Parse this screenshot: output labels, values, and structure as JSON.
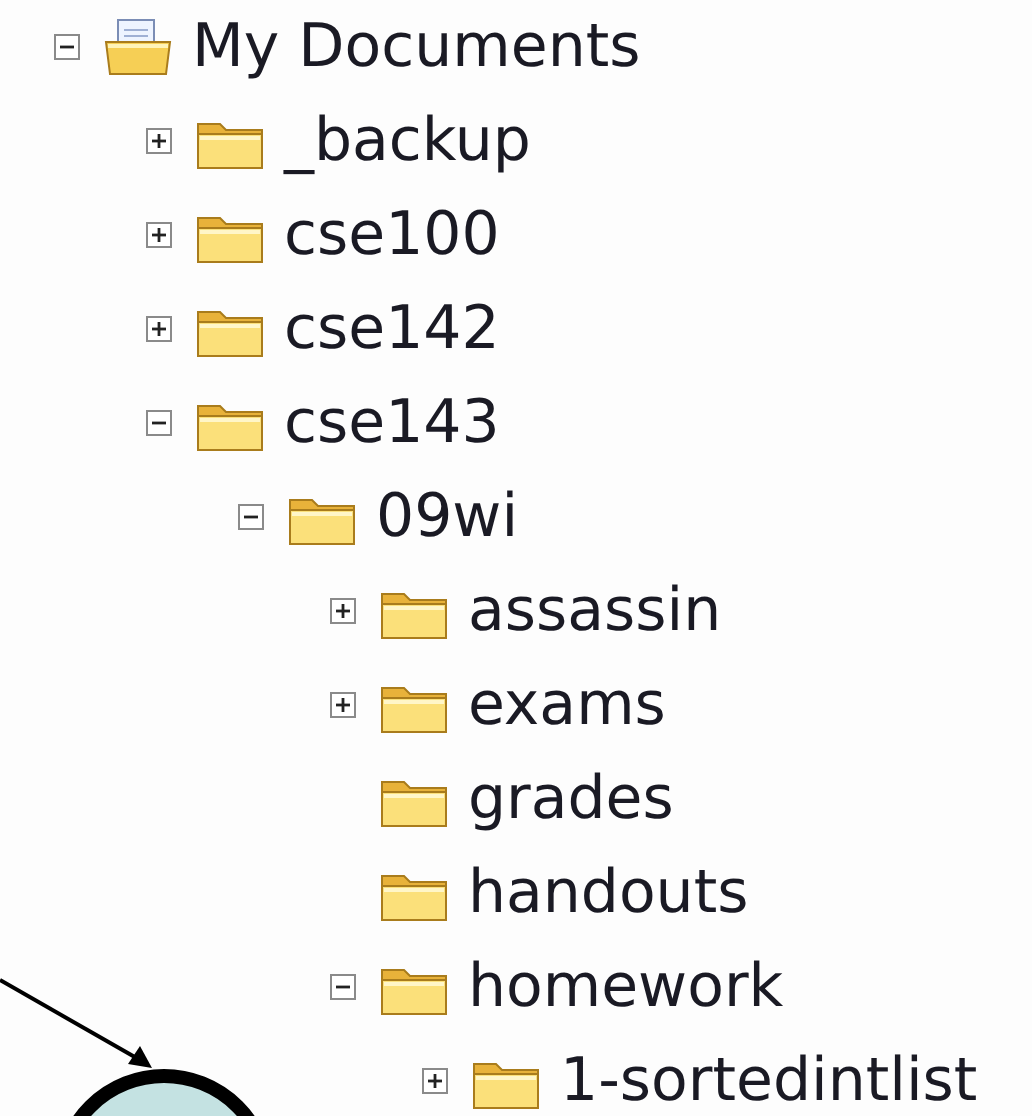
{
  "tree": [
    {
      "label": "My Documents",
      "kind": "documents",
      "expanded": true,
      "children": [
        {
          "label": "_backup",
          "kind": "folder",
          "expanded": false
        },
        {
          "label": "cse100",
          "kind": "folder",
          "expanded": false
        },
        {
          "label": "cse142",
          "kind": "folder",
          "expanded": false
        },
        {
          "label": "cse143",
          "kind": "folder",
          "expanded": true,
          "children": [
            {
              "label": "09wi",
              "kind": "folder",
              "expanded": true,
              "children": [
                {
                  "label": "assassin",
                  "kind": "folder",
                  "expanded": false
                },
                {
                  "label": "exams",
                  "kind": "folder",
                  "expanded": false
                },
                {
                  "label": "grades",
                  "kind": "folder"
                },
                {
                  "label": "handouts",
                  "kind": "folder"
                },
                {
                  "label": "homework",
                  "kind": "folder",
                  "expanded": true,
                  "children": [
                    {
                      "label": "1-sortedintlist",
                      "kind": "folder",
                      "expanded": false
                    }
                  ]
                }
              ]
            }
          ]
        }
      ]
    }
  ]
}
